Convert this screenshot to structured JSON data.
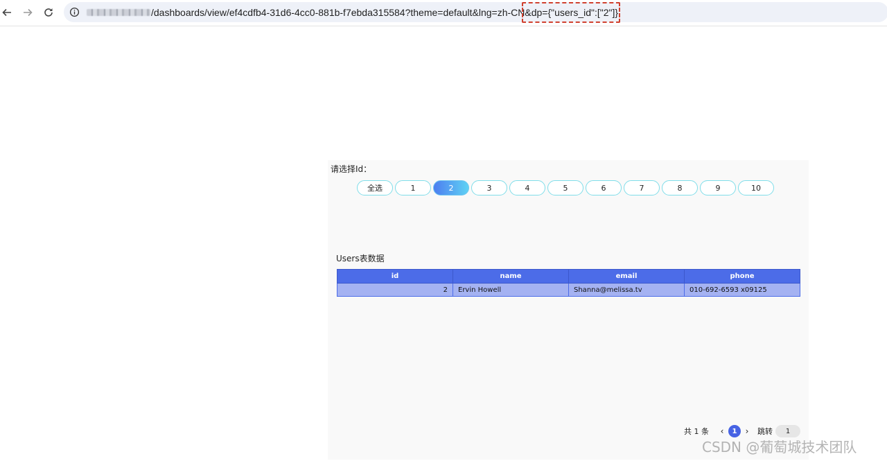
{
  "browser": {
    "url_path": "/dashboards/view/ef4cdfb4-31d6-4cc0-881b-f7ebda315584?theme=default&lng=zh-CN",
    "url_param_highlighted": "&dp={\"users_id\":[\"2\"]}"
  },
  "filter": {
    "label": "请选择Id：",
    "options": [
      "全选",
      "1",
      "2",
      "3",
      "4",
      "5",
      "6",
      "7",
      "8",
      "9",
      "10"
    ],
    "selected": "2"
  },
  "table": {
    "title": "Users表数据",
    "columns": [
      "id",
      "name",
      "email",
      "phone"
    ],
    "rows": [
      [
        "2",
        "Ervin Howell",
        "Shanna@melissa.tv",
        "010-692-6593 x09125"
      ]
    ]
  },
  "pagination": {
    "total_label": "共 1 条",
    "current_page": "1",
    "jump_label": "跳转",
    "jump_value": "1"
  },
  "watermark": "CSDN @葡萄城技术团队",
  "colors": {
    "accent": "#4c6ce8",
    "chip_border": "#7fdde9",
    "highlight_box": "#d0402e"
  }
}
